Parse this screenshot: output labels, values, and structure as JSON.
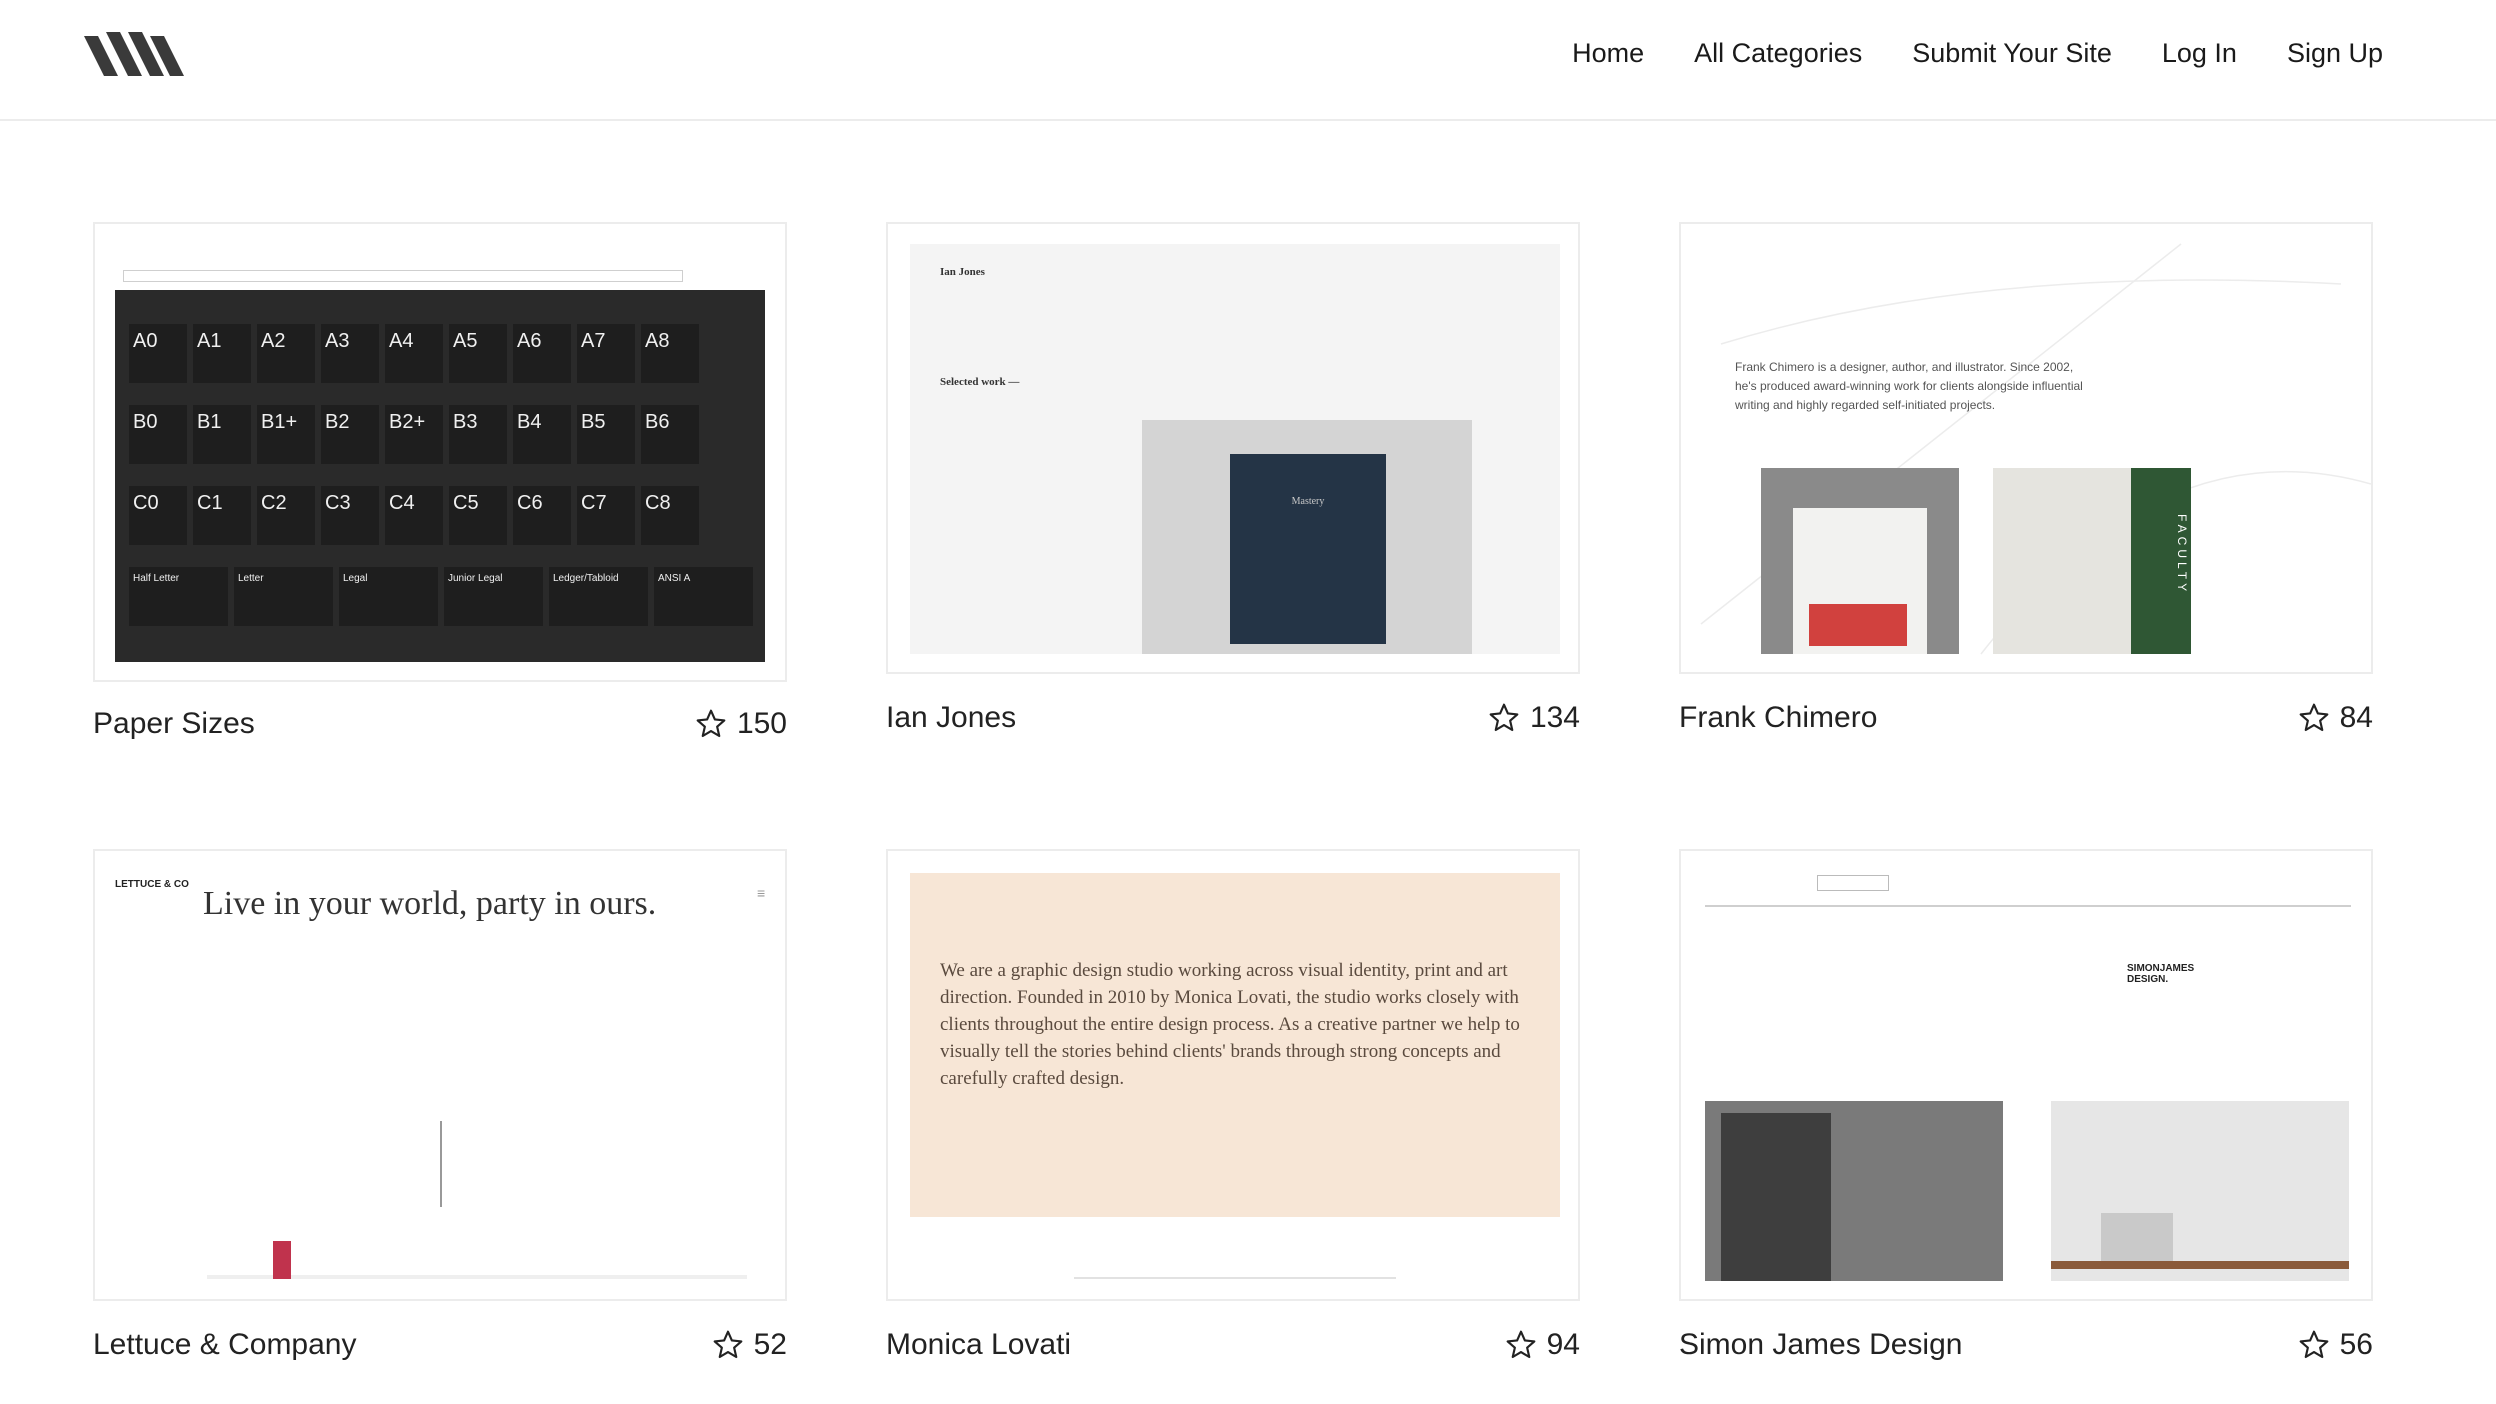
{
  "header": {
    "nav": [
      "Home",
      "All Categories",
      "Submit Your Site",
      "Log In",
      "Sign Up"
    ]
  },
  "icons": {
    "logo": "stripes-logo-icon",
    "rating": "star-icon"
  },
  "colors": {
    "accent_red": "#c0334d",
    "faculty_green": "#2f5734",
    "monica_bg": "#f7e6d6"
  },
  "sites": [
    {
      "title": "Paper Sizes",
      "stars": "150",
      "preview": {
        "rows": [
          [
            "A0",
            "A1",
            "A2",
            "A3",
            "A4",
            "A5",
            "A6",
            "A7",
            "A8"
          ],
          [
            "B0",
            "B1",
            "B1+",
            "B2",
            "B2+",
            "B3",
            "B4",
            "B5",
            "B6"
          ],
          [
            "C0",
            "C1",
            "C2",
            "C3",
            "C4",
            "C5",
            "C6",
            "C7",
            "C8"
          ],
          [
            "Half Letter",
            "Letter",
            "Legal",
            "Junior Legal",
            "Ledger/Tabloid",
            "ANSI A"
          ]
        ]
      }
    },
    {
      "title": "Ian Jones",
      "stars": "134",
      "preview": {
        "name": "Ian Jones",
        "section": "Selected work —",
        "book": "Mastery"
      }
    },
    {
      "title": "Frank Chimero",
      "stars": "84",
      "preview": {
        "bio": "Frank Chimero is a designer, author, and illustrator. Since 2002, he's produced award-winning work for clients alongside influential writing and highly regarded self-initiated projects.",
        "book_spine": "FACULTY"
      }
    },
    {
      "title": "Lettuce & Company",
      "stars": "52",
      "preview": {
        "brand": "LETTUCE & CO",
        "headline": "Live in your world, party in ours."
      }
    },
    {
      "title": "Monica Lovati",
      "stars": "94",
      "preview": {
        "intro": "We are a graphic design studio working across visual identity, print and art direction. Founded in 2010 by Monica Lovati, the studio works closely with clients throughout the entire design process. As a creative partner we help to visually tell the stories behind clients' brands through strong concepts and carefully crafted design."
      }
    },
    {
      "title": "Simon James Design",
      "stars": "56",
      "preview": {
        "logo": "SIMONJAMES DESIGN."
      }
    }
  ]
}
